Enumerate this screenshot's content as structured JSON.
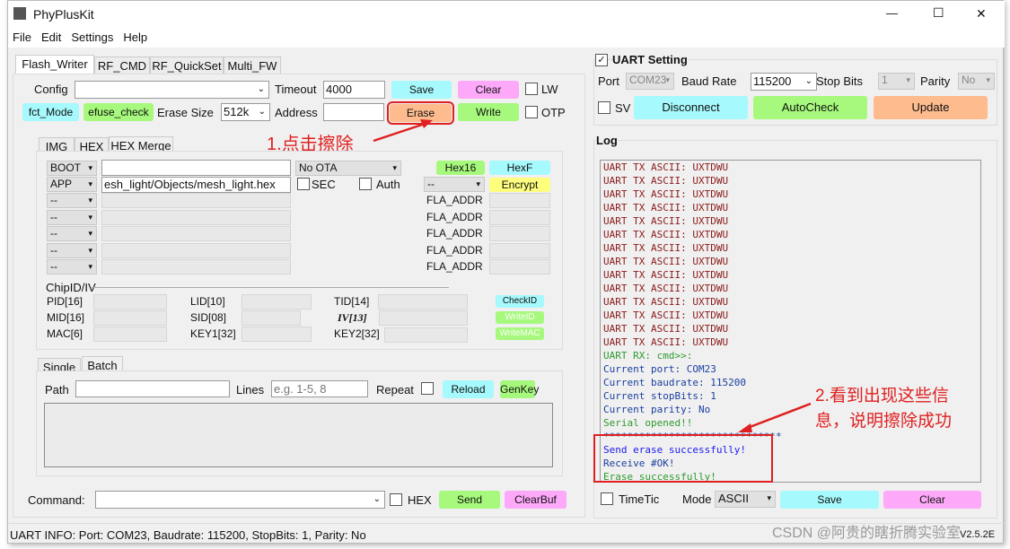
{
  "window": {
    "title": "PhyPlusKit",
    "min": "—",
    "max": "☐",
    "close": "✕"
  },
  "menu": [
    "File",
    "Edit",
    "Settings",
    "Help"
  ],
  "tabs": [
    "Flash_Writer",
    "RF_CMD",
    "RF_QuickSet",
    "Multi_FW"
  ],
  "config": {
    "config_label": "Config",
    "timeout_label": "Timeout",
    "timeout_value": "4000",
    "save": "Save",
    "clear": "Clear",
    "lw": "LW",
    "fct_mode": "fct_Mode",
    "efuse_check": "efuse_check",
    "erase_size_label": "Erase Size",
    "erase_size": "512k",
    "address_label": "Address",
    "erase": "Erase",
    "write": "Write",
    "otp": "OTP"
  },
  "subtabs": [
    "IMG",
    "HEX",
    "HEX Merge"
  ],
  "hexmerge": {
    "boot": "BOOT",
    "app": "APP",
    "app_path": "esh_light/Objects/mesh_light.hex",
    "ota": "No OTA",
    "sec": "SEC",
    "auth": "Auth",
    "hex16": "Hex16",
    "hexf": "HexF",
    "encrypt": "Encrypt",
    "enc_sel": "--",
    "empty": "--",
    "fla_addr": "FLA_ADDR"
  },
  "chipid": {
    "title": "ChipID/IV",
    "pid": "PID[16]",
    "lid": "LID[10]",
    "tid": "TID[14]",
    "checkid": "CheckID",
    "mid": "MID[16]",
    "sid": "SID[08]",
    "iv": "IV[13]",
    "writeid": "WriteID",
    "mac": "MAC[6]",
    "key1": "KEY1[32]",
    "key2": "KEY2[32]",
    "writemac": "WriteMAC"
  },
  "batch": {
    "tabs": [
      "Single",
      "Batch"
    ],
    "path_label": "Path",
    "lines_label": "Lines",
    "lines_placeholder": "e.g. 1-5, 8",
    "repeat": "Repeat",
    "reload": "Reload",
    "genkey": "GenKey"
  },
  "command": {
    "label": "Command:",
    "hex": "HEX",
    "send": "Send",
    "clearbuf": "ClearBuf"
  },
  "status": "UART INFO: Port: COM23, Baudrate: 115200, StopBits: 1, Parity: No",
  "uart": {
    "title": "UART Setting",
    "port_label": "Port",
    "port": "COM23",
    "baud_label": "Baud Rate",
    "baud": "115200",
    "stop_label": "Stop Bits",
    "stop": "1",
    "parity_label": "Parity",
    "parity": "No",
    "sv": "SV",
    "disconnect": "Disconnect",
    "autocheck": "AutoCheck",
    "update": "Update"
  },
  "log": {
    "title": "Log",
    "lines": [
      {
        "t": "UART TX ASCII: UXTDWU",
        "c": "#8b1a1a"
      },
      {
        "t": "UART TX ASCII: UXTDWU",
        "c": "#8b1a1a"
      },
      {
        "t": "UART TX ASCII: UXTDWU",
        "c": "#8b1a1a"
      },
      {
        "t": "UART TX ASCII: UXTDWU",
        "c": "#8b1a1a"
      },
      {
        "t": "UART TX ASCII: UXTDWU",
        "c": "#8b1a1a"
      },
      {
        "t": "UART TX ASCII: UXTDWU",
        "c": "#8b1a1a"
      },
      {
        "t": "UART TX ASCII: UXTDWU",
        "c": "#8b1a1a"
      },
      {
        "t": "UART TX ASCII: UXTDWU",
        "c": "#8b1a1a"
      },
      {
        "t": "UART TX ASCII: UXTDWU",
        "c": "#8b1a1a"
      },
      {
        "t": "UART TX ASCII: UXTDWU",
        "c": "#8b1a1a"
      },
      {
        "t": "UART TX ASCII: UXTDWU",
        "c": "#8b1a1a"
      },
      {
        "t": "UART TX ASCII: UXTDWU",
        "c": "#8b1a1a"
      },
      {
        "t": "UART TX ASCII: UXTDWU",
        "c": "#8b1a1a"
      },
      {
        "t": "UART TX ASCII: UXTDWU",
        "c": "#8b1a1a"
      },
      {
        "t": "UART RX: cmd>>:",
        "c": "#2e9a2e"
      },
      {
        "t": "Current port: COM23",
        "c": "#1a3fa0"
      },
      {
        "t": "Current baudrate: 115200",
        "c": "#1a3fa0"
      },
      {
        "t": "Current stopBits: 1",
        "c": "#1a3fa0"
      },
      {
        "t": "Current parity: No",
        "c": "#1a3fa0"
      },
      {
        "t": "Serial opened!!",
        "c": "#2e9a2e"
      },
      {
        "t": "******************************",
        "c": "#1a3fa0"
      },
      {
        "t": "Send erase successfully!",
        "c": "#1a1af0"
      },
      {
        "t": "Receive #OK!",
        "c": "#1a3fa0"
      },
      {
        "t": "Erase successfully!",
        "c": "#2e9a2e"
      }
    ],
    "timetic": "TimeTic",
    "mode_label": "Mode",
    "mode": "ASCII",
    "save": "Save",
    "clear": "Clear"
  },
  "version": "V2.5.2E",
  "annotations": {
    "step1": "1.点击擦除",
    "step2_line1": "2.看到出现这些信",
    "step2_line2": "息，说明擦除成功"
  },
  "watermark": "CSDN @阿贵的瞎折腾实验室"
}
